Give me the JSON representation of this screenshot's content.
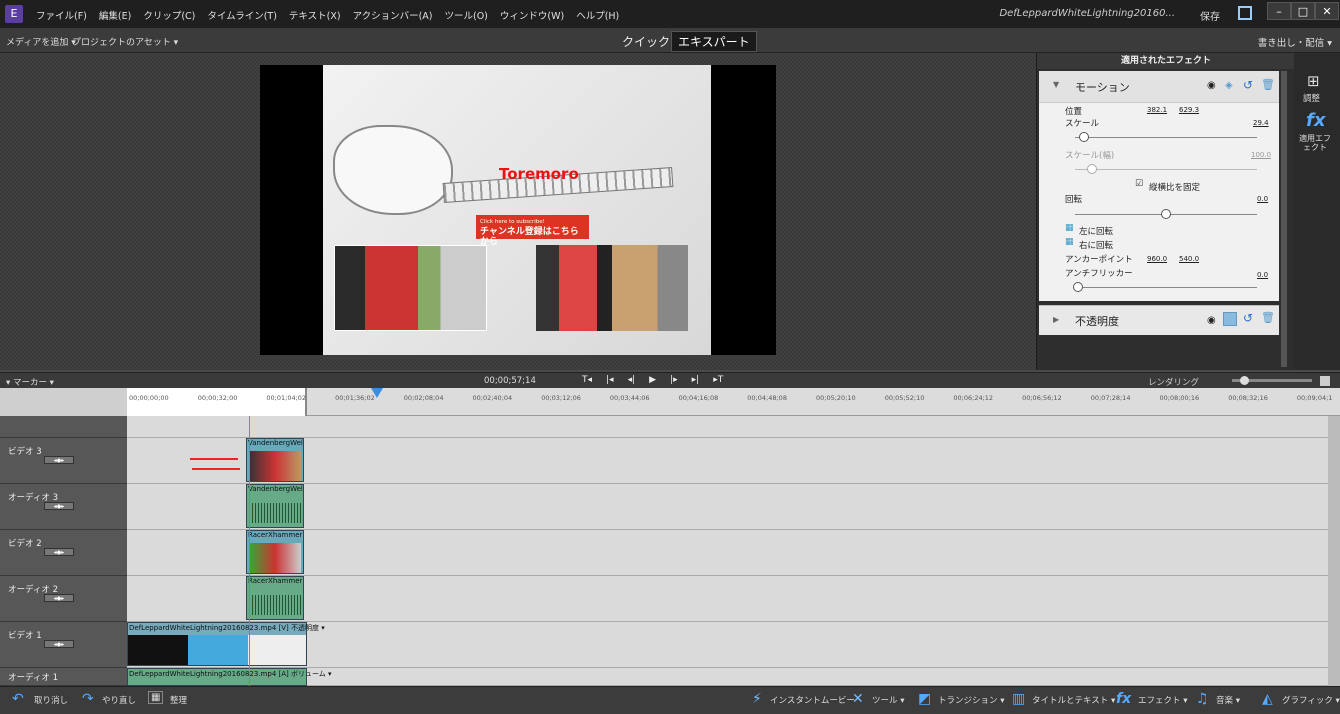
{
  "app": {
    "icon_text": "E",
    "doc_title": "DefLeppardWhiteLightning20160...",
    "save_label": "保存"
  },
  "menu": [
    "ファイル(F)",
    "編集(E)",
    "クリップ(C)",
    "タイムライン(T)",
    "テキスト(X)",
    "アクションバー(A)",
    "ツール(O)",
    "ウィンドウ(W)",
    "ヘルプ(H)"
  ],
  "window_buttons": [
    "–",
    "□",
    "✕"
  ],
  "toolbar": {
    "add_media": "メディアを追加 ▾",
    "project_assets": "プロジェクトのアセット ▾",
    "mode_quick": "クイック",
    "mode_expert": "エキスパート",
    "export": "書き出し・配信 ▾"
  },
  "preview": {
    "overlay_title": "Toremoro",
    "subscribe_small": "Click here to subscribe!",
    "subscribe_big": "チャンネル登録はこちらから"
  },
  "effects_panel": {
    "title": "適用されたエフェクト",
    "motion": {
      "label": "モーション",
      "position_label": "位置",
      "position_x": "382.1",
      "position_y": "629.3",
      "scale_label": "スケール",
      "scale_value": "29.4",
      "scale_width_label": "スケール(幅)",
      "scale_width_value": "100.0",
      "lock_aspect_label": "縦横比を固定",
      "rotation_label": "回転",
      "rotation_value": "0.0",
      "rotate_left": "左に回転",
      "rotate_right": "右に回転",
      "anchor_label": "アンカーポイント",
      "anchor_x": "960.0",
      "anchor_y": "540.0",
      "antiflicker_label": "アンチフリッカー",
      "antiflicker_value": "0.0"
    },
    "opacity": {
      "label": "不透明度"
    },
    "side_tabs": {
      "adjust": "調整",
      "applied": "適用エフェクト"
    }
  },
  "timeline": {
    "marker_label": "▾ マーカー ▾",
    "timecode": "00;00;57;14",
    "transport": [
      "T◂",
      "|◂",
      "◂|",
      "▶",
      "|▸",
      "▸|",
      "▸T"
    ],
    "render_label": "レンダリング",
    "ticks": [
      "00;00;00;00",
      "00;00;32;00",
      "00;01;04;02",
      "00;01;36;02",
      "00;02;08;04",
      "00;02;40;04",
      "00;03;12;06",
      "00;03;44;06",
      "00;04;16;08",
      "00;04;48;08",
      "00;05;20;10",
      "00;05;52;10",
      "00;06;24;12",
      "00;06;56;12",
      "00;07;28;14",
      "00;08;00;16",
      "00;08;32;16",
      "00;09;04;1"
    ],
    "tracks": [
      {
        "name": "ビデオ 3",
        "clip": "VandenbergWel"
      },
      {
        "name": "オーディオ 3",
        "clip": "VandenbergWel"
      },
      {
        "name": "ビデオ 2",
        "clip": "RacerXhammer"
      },
      {
        "name": "オーディオ 2",
        "clip": "RacerXhammer"
      },
      {
        "name": "ビデオ 1",
        "clip": "DefLeppardWhiteLightning20160823.mp4 [V] 不透明度 ▾"
      },
      {
        "name": "オーディオ 1",
        "clip": "DefLeppardWhiteLightning20160823.mp4 [A] ボリューム ▾"
      }
    ]
  },
  "bottombar": {
    "undo": "取り消し",
    "redo": "やり直し",
    "organize": "整理",
    "instant_movie": "インスタントムービー",
    "tools": "ツール ▾",
    "transitions": "トランジション ▾",
    "titles": "タイトルとテキスト ▾",
    "effects": "エフェクト ▾",
    "music": "音楽 ▾",
    "graphics": "グラフィック ▾"
  }
}
